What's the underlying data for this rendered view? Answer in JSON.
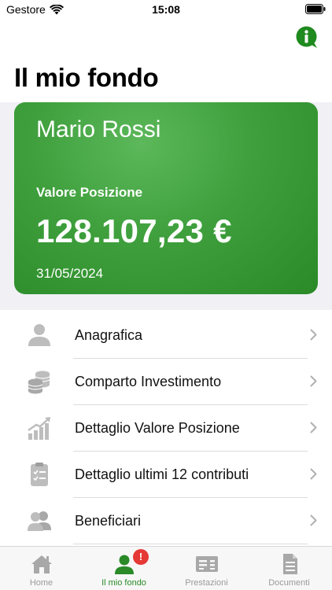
{
  "status_bar": {
    "carrier": "Gestore",
    "time": "15:08"
  },
  "header": {
    "title": "Il mio fondo",
    "info_icon": "info-icon"
  },
  "card": {
    "name": "Mario Rossi",
    "label": "Valore Posizione",
    "value": "128.107,23 €",
    "date": "31/05/2024",
    "color": "#3e9f3c"
  },
  "menu": {
    "items": [
      {
        "label": "Anagrafica",
        "icon": "person-icon"
      },
      {
        "label": "Comparto Investimento",
        "icon": "coins-icon"
      },
      {
        "label": "Dettaglio Valore Posizione",
        "icon": "growth-chart-icon"
      },
      {
        "label": "Dettaglio ultimi 12 contributi",
        "icon": "clipboard-list-icon"
      },
      {
        "label": "Beneficiari",
        "icon": "people-icon"
      }
    ]
  },
  "tab_bar": {
    "tabs": [
      {
        "label": "Home",
        "icon": "home-icon"
      },
      {
        "label": "Il mio fondo",
        "icon": "person-icon",
        "badge": "!"
      },
      {
        "label": "Prestazioni",
        "icon": "benefits-icon"
      },
      {
        "label": "Documenti",
        "icon": "document-icon"
      }
    ],
    "active_color": "#2a8a28"
  }
}
